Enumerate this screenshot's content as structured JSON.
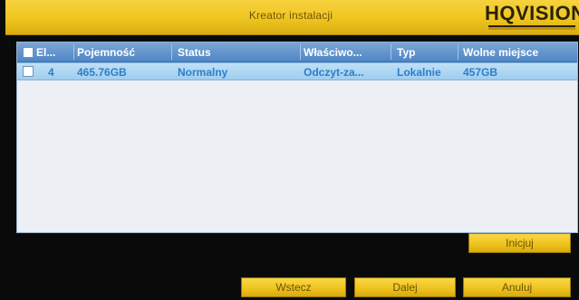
{
  "header": {
    "title": "Kreator instalacji",
    "logo": "HQVISION"
  },
  "table": {
    "columns": [
      "El...",
      "Pojemność",
      "Status",
      "Właściwo...",
      "Typ",
      "Wolne miejsce"
    ],
    "rows": [
      {
        "selected": true,
        "number": "4",
        "capacity": "465.76GB",
        "status": "Normalny",
        "property": "Odczyt-za...",
        "type": "Lokalnie",
        "free_space": "457GB"
      }
    ]
  },
  "buttons": {
    "init": "Inicjuj",
    "back": "Wstecz",
    "next": "Dalej",
    "cancel": "Anuluj"
  },
  "colors": {
    "accent_yellow": "#eec51f",
    "header_blue": "#4f86c4",
    "row_highlight": "#9fcdf0"
  }
}
